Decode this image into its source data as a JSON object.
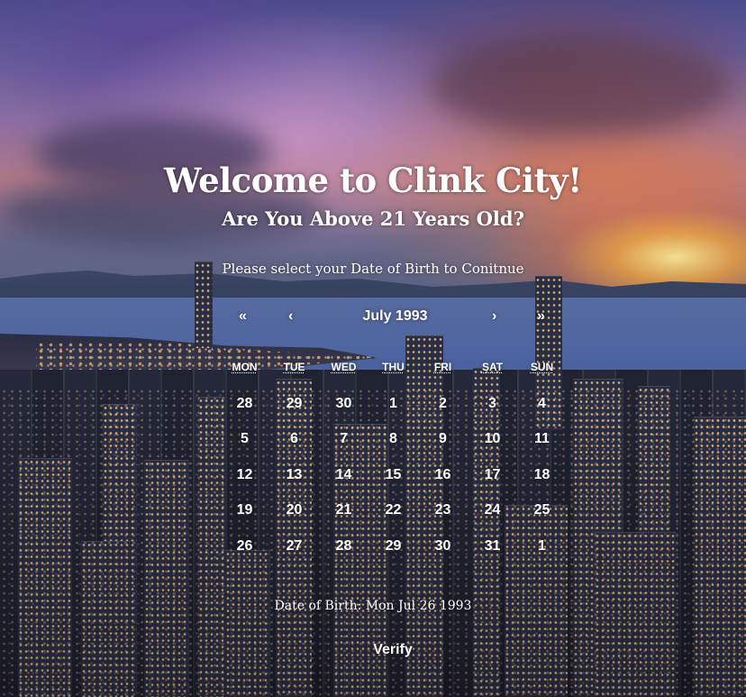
{
  "page": {
    "title": "Welcome to Clink City!",
    "subtitle": "Are You Above 21 Years Old?",
    "instruction": "Please select your Date of Birth to Conitnue"
  },
  "calendar": {
    "nav": {
      "prev_year": "«",
      "prev_month": "‹",
      "next_month": "›",
      "next_year": "»"
    },
    "month_label": "July 1993",
    "weekdays": [
      "MON",
      "TUE",
      "WED",
      "THU",
      "FRI",
      "SAT",
      "SUN"
    ],
    "weeks": [
      [
        "28",
        "29",
        "30",
        "1",
        "2",
        "3",
        "4"
      ],
      [
        "5",
        "6",
        "7",
        "8",
        "9",
        "10",
        "11"
      ],
      [
        "12",
        "13",
        "14",
        "15",
        "16",
        "17",
        "18"
      ],
      [
        "19",
        "20",
        "21",
        "22",
        "23",
        "24",
        "25"
      ],
      [
        "26",
        "27",
        "28",
        "29",
        "30",
        "31",
        "1"
      ]
    ]
  },
  "dob_text": "Date of Birth: Mon Jul 26 1993",
  "verify_label": "Verify",
  "colors": {
    "text": "#ffffff",
    "sky_sunset": "#ff9a3c",
    "sky_purple": "#6c5f9e",
    "water": "#4f68a8",
    "city": "#262a3a"
  },
  "background": {
    "icon": "city-skyline-sunset-photo"
  }
}
